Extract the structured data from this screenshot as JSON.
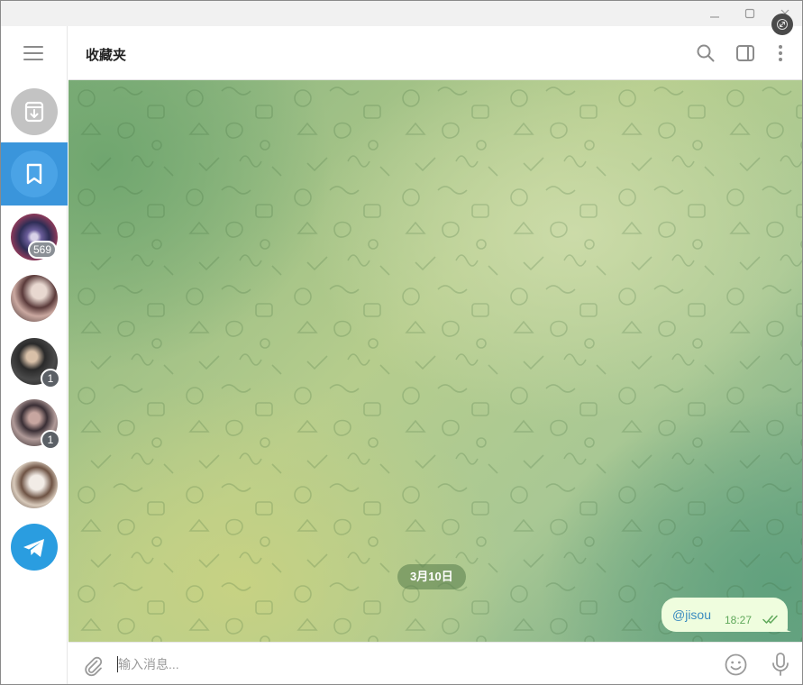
{
  "window": {
    "controls": {
      "minimize": "–",
      "maximize": "☐",
      "close": "×"
    }
  },
  "sidebar": {
    "menu_icon": "hamburger-menu-icon",
    "items": [
      {
        "name": "archive",
        "icon": "archive-icon",
        "active": false
      },
      {
        "name": "saved-messages",
        "icon": "bookmark-icon",
        "active": true
      },
      {
        "name": "chat-1",
        "badge": "569"
      },
      {
        "name": "chat-2"
      },
      {
        "name": "chat-3",
        "story_count": "1"
      },
      {
        "name": "chat-4",
        "story_count": "1"
      },
      {
        "name": "chat-5"
      },
      {
        "name": "telegram",
        "icon": "telegram-icon"
      }
    ]
  },
  "header": {
    "title": "收藏夹",
    "icons": [
      "search-icon",
      "sidebar-toggle-icon",
      "more-vertical-icon"
    ]
  },
  "chat": {
    "date_separator": "3月10日",
    "messages": [
      {
        "text": "@jisou",
        "time": "18:27",
        "status": "read"
      }
    ]
  },
  "composer": {
    "placeholder": "输入消息...",
    "icons": [
      "attach-icon",
      "emoji-icon",
      "microphone-icon"
    ]
  },
  "colors": {
    "accent": "#3a95db",
    "bubble_out": "#effdde",
    "badge_gray": "#8a8f95",
    "telegram_blue": "#2a9de0"
  }
}
